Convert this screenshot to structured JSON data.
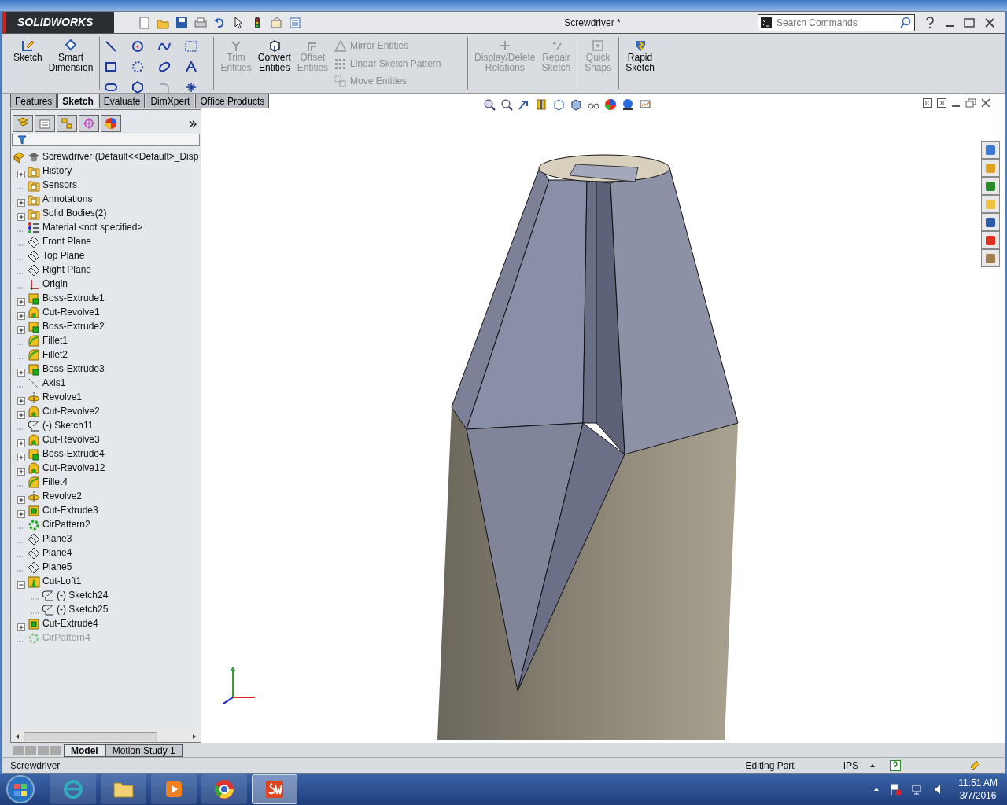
{
  "window": {
    "title": "Screwdriver *",
    "logo": "SOLIDWORKS"
  },
  "search": {
    "placeholder": "Search Commands"
  },
  "ribbon_groups": [
    [
      {
        "kind": "large",
        "label": "Sketch",
        "disabled": false
      },
      {
        "kind": "large",
        "label": "Smart Dimension",
        "disabled": false
      }
    ],
    [
      {
        "kind": "large",
        "label": "Trim Entities",
        "disabled": true
      },
      {
        "kind": "large",
        "label": "Convert Entities",
        "disabled": false
      },
      {
        "kind": "large",
        "label": "Offset Entities",
        "disabled": true
      },
      {
        "kind": "small",
        "label": "Mirror Entities",
        "disabled": true
      },
      {
        "kind": "small",
        "label": "Linear Sketch Pattern",
        "disabled": true
      },
      {
        "kind": "small",
        "label": "Move Entities",
        "disabled": true
      }
    ],
    [
      {
        "kind": "large",
        "label": "Display/Delete Relations",
        "disabled": true
      },
      {
        "kind": "large",
        "label": "Repair Sketch",
        "disabled": true
      }
    ],
    [
      {
        "kind": "large",
        "label": "Quick Snaps",
        "disabled": true
      }
    ],
    [
      {
        "kind": "large",
        "label": "Rapid Sketch",
        "disabled": false
      }
    ]
  ],
  "tabs": [
    {
      "label": "Features",
      "selected": false
    },
    {
      "label": "Sketch",
      "selected": true
    },
    {
      "label": "Evaluate",
      "selected": false
    },
    {
      "label": "DimXpert",
      "selected": false
    },
    {
      "label": "Office Products",
      "selected": false
    }
  ],
  "tree": {
    "root": "Screwdriver  (Default<<Default>_Disp",
    "items": [
      {
        "kind": "folder",
        "label": "History",
        "expandable": true,
        "expanded": false,
        "suppressed": false
      },
      {
        "kind": "folder",
        "label": "Sensors",
        "expandable": false,
        "suppressed": false
      },
      {
        "kind": "folder",
        "label": "Annotations",
        "expandable": true,
        "expanded": false,
        "suppressed": false
      },
      {
        "kind": "folder",
        "label": "Solid Bodies(2)",
        "expandable": true,
        "expanded": false,
        "suppressed": false
      },
      {
        "kind": "material",
        "label": "Material <not specified>",
        "expandable": false,
        "suppressed": false
      },
      {
        "kind": "plane",
        "label": "Front Plane",
        "expandable": false,
        "suppressed": false
      },
      {
        "kind": "plane",
        "label": "Top Plane",
        "expandable": false,
        "suppressed": false
      },
      {
        "kind": "plane",
        "label": "Right Plane",
        "expandable": false,
        "suppressed": false
      },
      {
        "kind": "origin",
        "label": "Origin",
        "expandable": false,
        "suppressed": false
      },
      {
        "kind": "extrude",
        "label": "Boss-Extrude1",
        "expandable": true,
        "expanded": false,
        "suppressed": false
      },
      {
        "kind": "cut-revolve",
        "label": "Cut-Revolve1",
        "expandable": true,
        "expanded": false,
        "suppressed": false
      },
      {
        "kind": "extrude",
        "label": "Boss-Extrude2",
        "expandable": true,
        "expanded": false,
        "suppressed": false
      },
      {
        "kind": "fillet",
        "label": "Fillet1",
        "expandable": false,
        "suppressed": false
      },
      {
        "kind": "fillet",
        "label": "Fillet2",
        "expandable": false,
        "suppressed": false
      },
      {
        "kind": "extrude",
        "label": "Boss-Extrude3",
        "expandable": true,
        "expanded": false,
        "suppressed": false
      },
      {
        "kind": "axis",
        "label": "Axis1",
        "expandable": false,
        "suppressed": false
      },
      {
        "kind": "revolve",
        "label": "Revolve1",
        "expandable": true,
        "expanded": false,
        "suppressed": false
      },
      {
        "kind": "cut-revolve",
        "label": "Cut-Revolve2",
        "expandable": true,
        "expanded": false,
        "suppressed": false
      },
      {
        "kind": "sketch",
        "label": "(-) Sketch11",
        "expandable": false,
        "suppressed": false
      },
      {
        "kind": "cut-revolve",
        "label": "Cut-Revolve3",
        "expandable": true,
        "expanded": false,
        "suppressed": false
      },
      {
        "kind": "extrude",
        "label": "Boss-Extrude4",
        "expandable": true,
        "expanded": false,
        "suppressed": false
      },
      {
        "kind": "cut-revolve",
        "label": "Cut-Revolve12",
        "expandable": true,
        "expanded": false,
        "suppressed": false
      },
      {
        "kind": "fillet",
        "label": "Fillet4",
        "expandable": false,
        "suppressed": false
      },
      {
        "kind": "revolve",
        "label": "Revolve2",
        "expandable": true,
        "expanded": false,
        "suppressed": false
      },
      {
        "kind": "cut-extrude",
        "label": "Cut-Extrude3",
        "expandable": true,
        "expanded": false,
        "suppressed": false
      },
      {
        "kind": "pattern",
        "label": "CirPattern2",
        "expandable": false,
        "suppressed": false
      },
      {
        "kind": "plane",
        "label": "Plane3",
        "expandable": false,
        "suppressed": false
      },
      {
        "kind": "plane",
        "label": "Plane4",
        "expandable": false,
        "suppressed": false
      },
      {
        "kind": "plane",
        "label": "Plane5",
        "expandable": false,
        "suppressed": false
      },
      {
        "kind": "loft",
        "label": "Cut-Loft1",
        "expandable": true,
        "expanded": true,
        "suppressed": false,
        "children": [
          {
            "kind": "sketch",
            "label": "(-) Sketch24",
            "expandable": false,
            "suppressed": false
          },
          {
            "kind": "sketch",
            "label": "(-) Sketch25",
            "expandable": false,
            "suppressed": false
          }
        ]
      },
      {
        "kind": "cut-extrude",
        "label": "Cut-Extrude4",
        "expandable": true,
        "expanded": false,
        "suppressed": false
      },
      {
        "kind": "pattern",
        "label": "CirPattern4",
        "expandable": false,
        "suppressed": true
      }
    ]
  },
  "bottom_tabs": [
    {
      "label": "Model",
      "selected": true
    },
    {
      "label": "Motion Study 1",
      "selected": false
    }
  ],
  "status_bar": {
    "document": "Screwdriver",
    "mode": "Editing Part",
    "units": "IPS"
  },
  "taskbar": {
    "apps": [
      {
        "kind": "browser",
        "selected": false
      },
      {
        "kind": "explorer",
        "selected": false
      },
      {
        "kind": "media",
        "selected": false
      },
      {
        "kind": "chrome",
        "selected": false
      },
      {
        "kind": "cad",
        "selected": true
      }
    ],
    "time": "11:51 AM",
    "date": "3/7/2016"
  }
}
